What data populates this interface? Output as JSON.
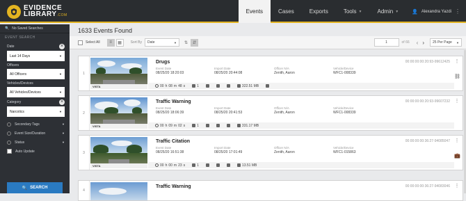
{
  "app": {
    "logo_line1": "EVIDENCE",
    "logo_line2": "LIBRARY",
    "logo_suffix": ".COM"
  },
  "nav": {
    "items": [
      "Events",
      "Cases",
      "Exports",
      "Tools",
      "Admin"
    ],
    "active": "Events",
    "user": "Alexandra Yazdi"
  },
  "sidebar": {
    "saved": "No Saved Searches",
    "section": "EVENT SEARCH",
    "date_label": "Date",
    "date_value": "Last 14 Days",
    "officers_label": "Officers",
    "officers_value": "All Officers",
    "vehicles_label": "Vehicles/Devices",
    "vehicles_value": "All Vehicles/Devices",
    "category_label": "Category",
    "category_value": "Narcotics",
    "rows": [
      "Secondary Tags",
      "Event Size/Duration",
      "Status"
    ],
    "auto_update": "Auto Update",
    "search_button": "SEARCH"
  },
  "main": {
    "count": "1633 Events Found",
    "select_all": "Select All",
    "sort_by_label": "Sort By",
    "sort_by_value": "Date",
    "page_value": "1",
    "page_of": "of 66",
    "per_page": "25 Per Page"
  },
  "labels": {
    "event_date": "Event Date",
    "import_date": "Import Date",
    "officer": "Officer N/A",
    "vehicle": "Vehicle/Device"
  },
  "events": [
    {
      "num": "1",
      "title": "Drugs",
      "event_date": "08/25/20 18:20:03",
      "import_date": "08/25/20 20:44:08",
      "officer": "Zenith, Aaron",
      "device": "WFC1-008339",
      "event_id": "00:00:00:00:20:93-99612425",
      "duration_h": "00",
      "duration_m": "08",
      "duration_s": "48",
      "count": "1",
      "size": "322.51 MB",
      "brand": "VISTA"
    },
    {
      "num": "2",
      "title": "Traffic Warning",
      "event_date": "08/25/20 18:06:39",
      "import_date": "08/25/20 20:41:53",
      "officer": "Zenith, Aaron",
      "device": "WFC1-008339",
      "event_id": "00:00:00:00:20:93-99607232",
      "duration_h": "00",
      "duration_m": "09",
      "duration_s": "02",
      "count": "1",
      "size": "331.17 MB",
      "brand": "VISTA"
    },
    {
      "num": "3",
      "title": "Traffic Citation",
      "event_date": "08/25/20 16:51:38",
      "import_date": "08/25/20 17:01:49",
      "officer": "Zenith, Aaron",
      "device": "WFC1-015863",
      "event_id": "00:00:00:00:36:27-94085047",
      "duration_h": "00",
      "duration_m": "00",
      "duration_s": "23",
      "count": "1",
      "size": "13.51 MB",
      "brand": "VISTA"
    },
    {
      "num": "4",
      "title": "Traffic Warning",
      "event_id": "00:00:00:00:36:27-94083046"
    }
  ]
}
